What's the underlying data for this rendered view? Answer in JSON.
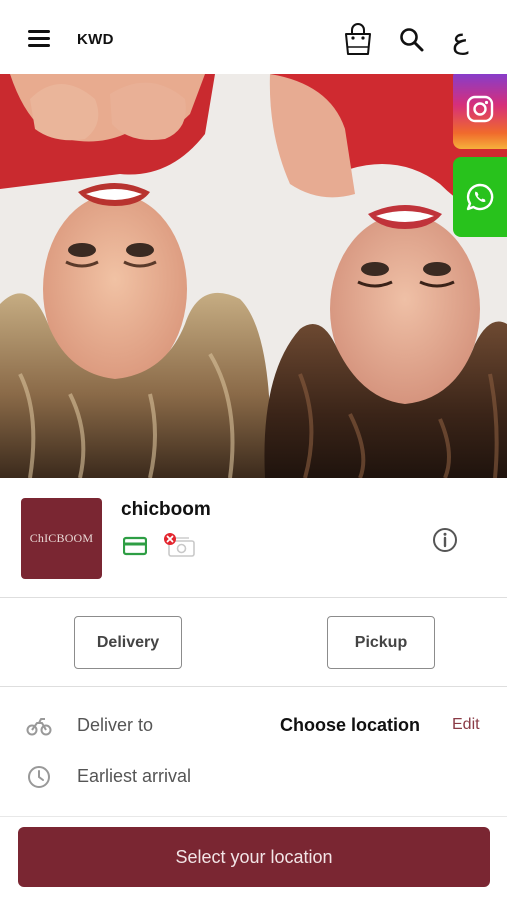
{
  "header": {
    "currency": "KWD",
    "language_toggle": "ع",
    "menu_icon": "hamburger-menu-icon",
    "cart_icon": "shopping-bag-icon",
    "search_icon": "search-icon"
  },
  "hero": {
    "image": "two-women-lying-upside-down-photo",
    "social": [
      {
        "name": "instagram",
        "icon": "instagram-icon"
      },
      {
        "name": "whatsapp",
        "icon": "whatsapp-icon"
      }
    ]
  },
  "store": {
    "logo_text": "ChICBOOM",
    "name": "chicboom",
    "payment_icons": [
      "credit-card-icon",
      "cash-unavailable-icon"
    ],
    "info_icon": "info-icon"
  },
  "modes": {
    "delivery_label": "Delivery",
    "pickup_label": "Pickup"
  },
  "location": {
    "deliver_to_label": "Deliver to",
    "choose_location": "Choose location",
    "edit_label": "Edit",
    "earliest_arrival_label": "Earliest arrival"
  },
  "cta": {
    "label": "Select your location"
  },
  "colors": {
    "brand": "#7a2632",
    "edit_link": "#8a3a45",
    "card_icon": "#2e9e44",
    "whatsapp": "#28c21c"
  }
}
